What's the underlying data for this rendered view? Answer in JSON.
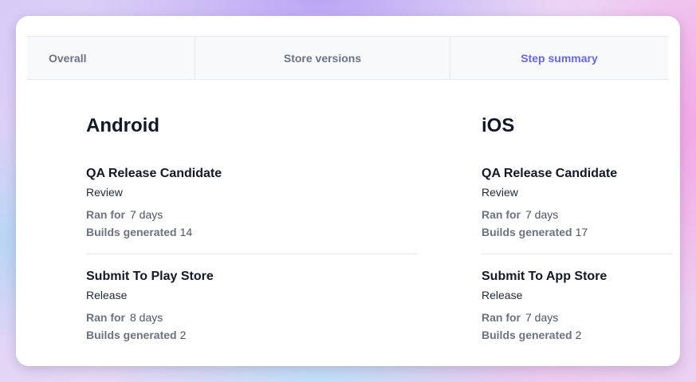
{
  "tabs": [
    {
      "label": "Overall"
    },
    {
      "label": "Store versions"
    },
    {
      "label": "Step summary",
      "active": true
    }
  ],
  "accent_color": "#6366f1",
  "platforms": [
    {
      "name": "Android",
      "steps": [
        {
          "title": "QA Release Candidate",
          "subtitle": "Review",
          "ran_for_label": "Ran for",
          "ran_for": "7 days",
          "builds_label": "Builds generated",
          "builds": "14"
        },
        {
          "title": "Submit To Play Store",
          "subtitle": "Release",
          "ran_for_label": "Ran for",
          "ran_for": "8 days",
          "builds_label": "Builds generated",
          "builds": "2"
        }
      ]
    },
    {
      "name": "iOS",
      "steps": [
        {
          "title": "QA Release Candidate",
          "subtitle": "Review",
          "ran_for_label": "Ran for",
          "ran_for": "7 days",
          "builds_label": "Builds generated",
          "builds": "17"
        },
        {
          "title": "Submit To App Store",
          "subtitle": "Release",
          "ran_for_label": "Ran for",
          "ran_for": "7 days",
          "builds_label": "Builds generated",
          "builds": "2"
        }
      ]
    }
  ]
}
